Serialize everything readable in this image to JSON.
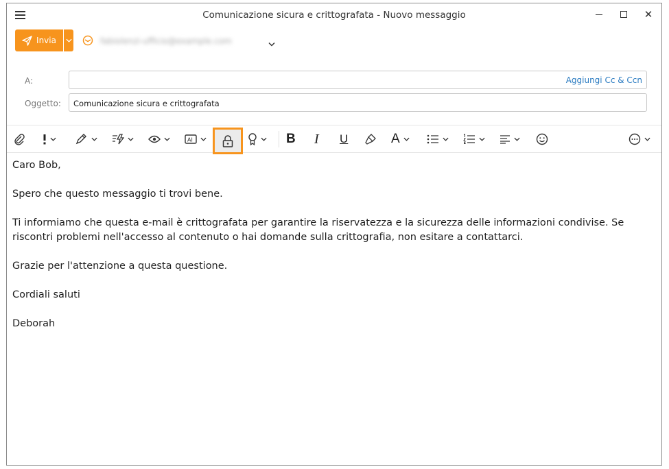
{
  "window": {
    "title": "Comunicazione sicura e crittografata - Nuovo messaggio"
  },
  "send": {
    "label": "Invia"
  },
  "from": {
    "address": "fabiolenzi-ufficio@example.com"
  },
  "fields": {
    "to_label": "A:",
    "to_value": "",
    "cc_link": "Aggiungi Cc & Ccn",
    "subject_label": "Oggetto:",
    "subject_value": "Comunicazione sicura e crittografata"
  },
  "toolbar": {
    "icons": [
      "paperclip-icon",
      "importance-icon",
      "signature-icon",
      "quick-actions-icon",
      "read-receipt-icon",
      "ai-icon",
      "lock-icon",
      "badge-icon",
      "bold-icon",
      "italic-icon",
      "underline-icon",
      "format-painter-icon",
      "font-color-icon",
      "bullet-list-icon",
      "numbered-list-icon",
      "align-icon",
      "emoji-icon",
      "more-icon"
    ],
    "highlight_color": "#f7941d"
  },
  "message": {
    "greeting": "Caro Bob,",
    "p1": "Spero che questo messaggio ti trovi bene.",
    "p2": "Ti informiamo che questa e-mail è crittografata per garantire la riservatezza e la sicurezza delle informazioni condivise. Se riscontri problemi nell'accesso al contenuto o hai domande sulla crittografia, non esitare a contattarci.",
    "p3": "Grazie per l'attenzione a questa questione.",
    "closing": "Cordiali saluti",
    "signature": "Deborah"
  },
  "colors": {
    "accent": "#f7941d",
    "link": "#2a7bc1"
  }
}
